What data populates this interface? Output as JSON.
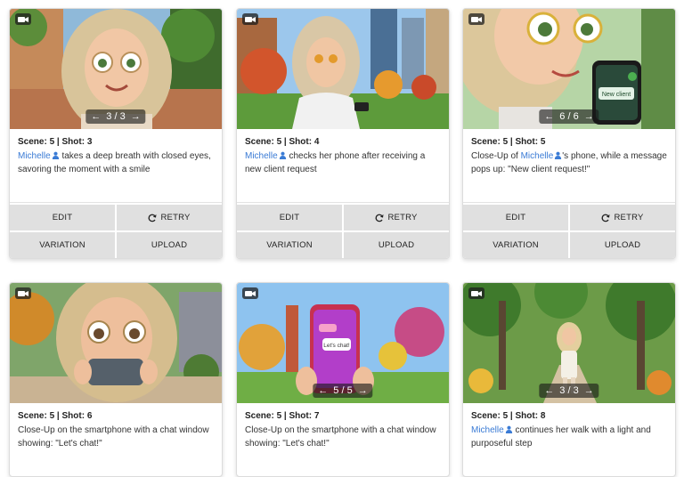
{
  "buttons": {
    "edit": "EDIT",
    "retry": "RETRY",
    "variation": "VARIATION",
    "upload": "UPLOAD"
  },
  "cards": [
    {
      "meta": "Scene: 5 | Shot: 3",
      "character": "Michelle",
      "before": "",
      "after": " takes a deep breath with closed eyes, savoring the moment with a smile",
      "pager": "3 / 3",
      "scene": "park-closeup"
    },
    {
      "meta": "Scene: 5 | Shot: 4",
      "character": "Michelle",
      "before": "",
      "after": " checks her phone after receiving a new client request",
      "pager": "",
      "scene": "city-park"
    },
    {
      "meta": "Scene: 5 | Shot: 5",
      "character": "Michelle",
      "before": "Close-Up of ",
      "after": "'s phone, while a message pops up: \"New client request!\"",
      "pager": "6 / 6",
      "scene": "phone-closeup",
      "phone_text": "New client"
    },
    {
      "meta": "Scene: 5 | Shot: 6",
      "character": "",
      "before": "Close-Up on the smartphone with a chat window showing: \"Let's chat!\"",
      "after": "",
      "pager": "",
      "scene": "face-phone"
    },
    {
      "meta": "Scene: 5 | Shot: 7",
      "character": "",
      "before": "Close-Up on the smartphone with a chat window showing: \"Let's chat!\"",
      "after": "",
      "pager": "5 / 5",
      "scene": "chat-phone",
      "phone_text": "Let's chat!"
    },
    {
      "meta": "Scene: 5 | Shot: 8",
      "character": "Michelle",
      "before": "",
      "after": " continues her walk with a light and purposeful step",
      "pager": "3 / 3",
      "scene": "walk-path"
    }
  ],
  "colors": {
    "character_link": "#3a7bd5",
    "button_bg": "#e0e0e0"
  }
}
